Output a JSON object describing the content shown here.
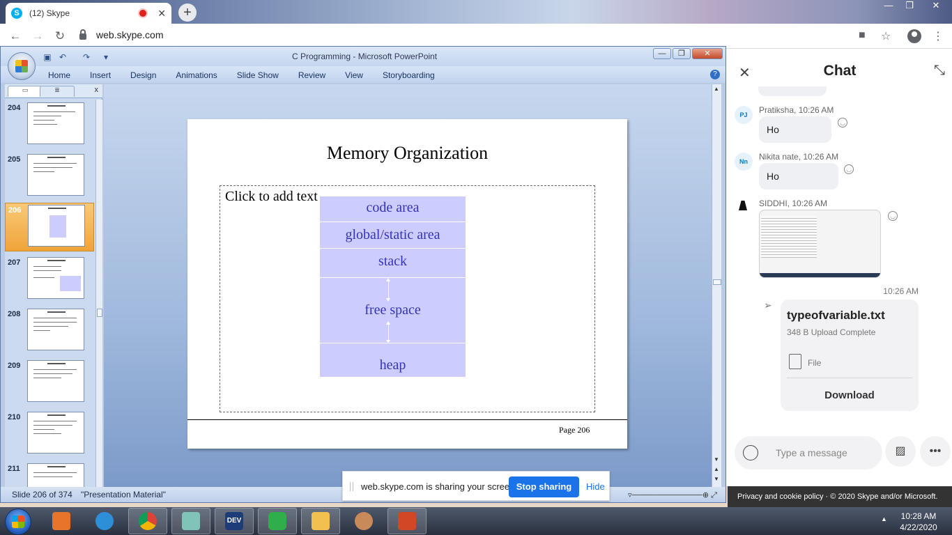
{
  "browser": {
    "tab_title": "(12) Skype",
    "tab_logo_letter": "S",
    "tab_close": "✕",
    "new_tab": "+",
    "url": "web.skype.com",
    "win_min": "—",
    "win_max": "❐",
    "win_close": "✕",
    "back_icon": "←",
    "forward_icon": "→",
    "reload_icon": "↻",
    "camera_icon": "■",
    "star_icon": "☆",
    "menu_icon": "⋮"
  },
  "powerpoint": {
    "window_title": "C Programming - Microsoft PowerPoint",
    "ribbon_tabs": [
      "Home",
      "Insert",
      "Design",
      "Animations",
      "Slide Show",
      "Review",
      "View",
      "Storyboarding"
    ],
    "help": "?",
    "thumb_close": "x",
    "thumbnails": [
      {
        "number": "204",
        "selected": false
      },
      {
        "number": "205",
        "selected": false
      },
      {
        "number": "206",
        "selected": true
      },
      {
        "number": "207",
        "selected": false
      },
      {
        "number": "208",
        "selected": false
      },
      {
        "number": "209",
        "selected": false
      },
      {
        "number": "210",
        "selected": false
      },
      {
        "number": "211",
        "selected": false
      }
    ],
    "slide": {
      "title": "Memory Organization",
      "placeholder": "Click to add text",
      "memory_blocks": [
        "code area",
        "global/static area",
        "stack",
        "free space",
        "heap"
      ],
      "page_label": "Page 206"
    },
    "status": {
      "slide_position": "Slide 206 of 374",
      "theme": "\"Presentation Material\""
    }
  },
  "share_bar": {
    "message": "web.skype.com is sharing your screen.",
    "stop_label": "Stop sharing",
    "hide_label": "Hide"
  },
  "chat": {
    "title": "Chat",
    "close_icon": "✕",
    "expand_icon": "⤡",
    "messages": [
      {
        "initials": "PJ",
        "sender": "Pratiksha, 10:26 AM",
        "text": "Ho"
      },
      {
        "initials": "Nn",
        "sender": "Nikita nate, 10:26 AM",
        "text": "Ho"
      },
      {
        "initials": "",
        "sender": "SIDDHI, 10:26 AM",
        "text": ""
      }
    ],
    "sent_time": "10:26 AM",
    "file": {
      "name": "typeofvariable.txt",
      "status": "348 B Upload Complete",
      "type_label": "File",
      "download_label": "Download"
    },
    "composer_placeholder": "Type a message",
    "more_icon": "•••",
    "footer": "Privacy and cookie policy  ·  © 2020 Skype and/or Microsoft."
  },
  "taskbar": {
    "time": "10:28 AM",
    "date": "4/22/2020",
    "dev_label": "DEV",
    "items": [
      {
        "name": "media-player",
        "color": "#e8742b"
      },
      {
        "name": "internet-explorer",
        "color": "#2d8fd8"
      },
      {
        "name": "chrome",
        "color": "#db4437"
      },
      {
        "name": "notes",
        "color": "#7fc4b6"
      },
      {
        "name": "dev-cpp",
        "color": "#1e3d78"
      },
      {
        "name": "downloader",
        "color": "#2fae4b"
      },
      {
        "name": "file-explorer",
        "color": "#f2c04f"
      },
      {
        "name": "paint",
        "color": "#c98a5a"
      },
      {
        "name": "powerpoint",
        "color": "#d24726"
      }
    ]
  }
}
